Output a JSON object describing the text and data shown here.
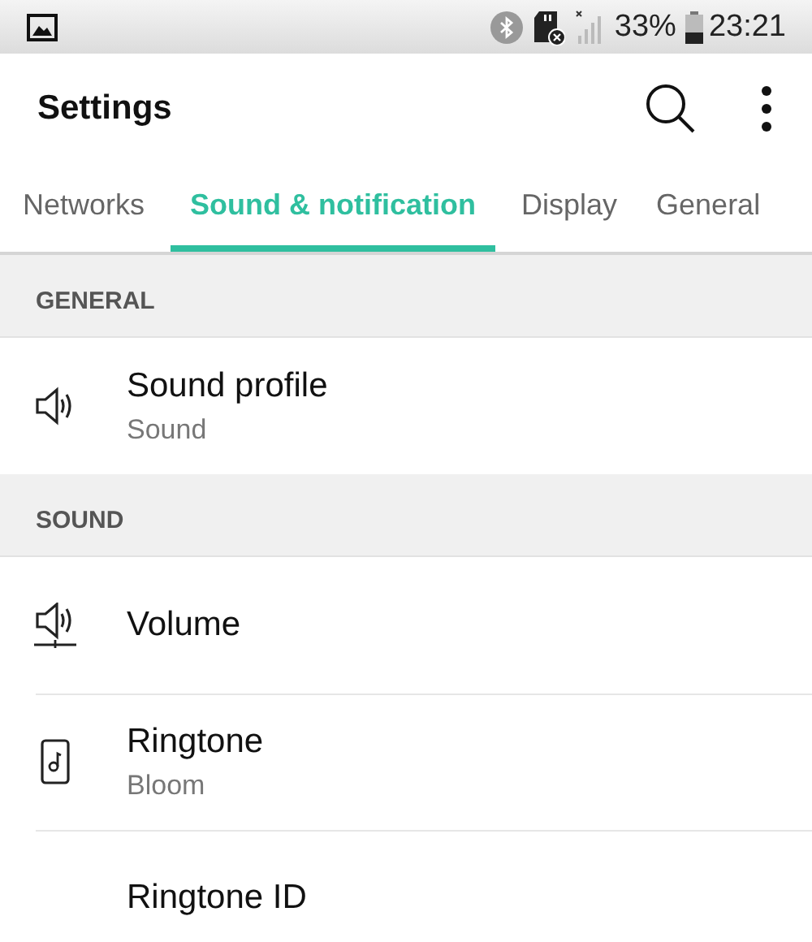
{
  "status_bar": {
    "battery": "33%",
    "time": "23:21"
  },
  "app_bar": {
    "title": "Settings"
  },
  "tabs": [
    {
      "label": "Networks",
      "selected": false
    },
    {
      "label": "Sound & notification",
      "selected": true
    },
    {
      "label": "Display",
      "selected": false
    },
    {
      "label": "General",
      "selected": false
    }
  ],
  "sections": [
    {
      "header": "GENERAL",
      "items": [
        {
          "kind": "speaker",
          "title": "Sound profile",
          "subtitle": "Sound"
        }
      ]
    },
    {
      "header": "SOUND",
      "items": [
        {
          "kind": "volume",
          "title": "Volume"
        },
        {
          "kind": "ringtone",
          "title": "Ringtone",
          "subtitle": "Bloom"
        },
        {
          "kind": "plain",
          "title": "Ringtone ID"
        }
      ]
    }
  ]
}
